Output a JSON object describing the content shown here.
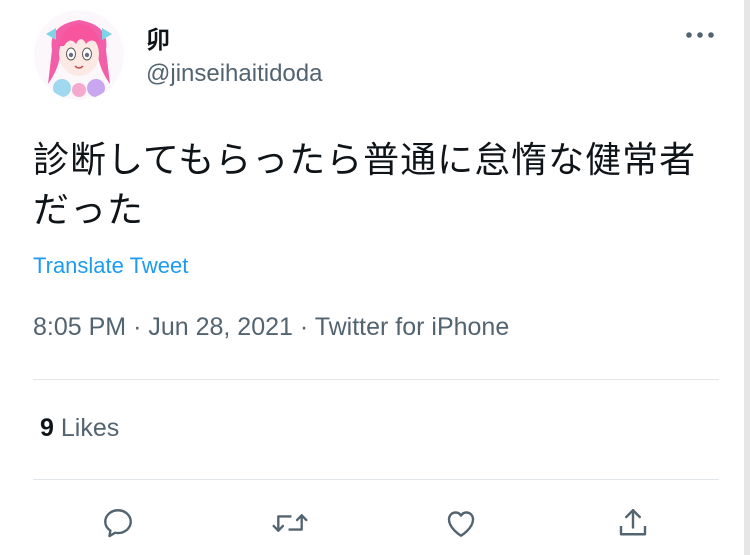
{
  "user": {
    "display_name": "卯",
    "handle": "@jinseihaitidoda",
    "avatar_icon": "anime-avatar"
  },
  "tweet": {
    "text": "診断してもらったら普通に怠惰な健常者だった",
    "translate_label": "Translate Tweet",
    "time": "8:05 PM",
    "date": "Jun 28, 2021",
    "source": "Twitter for iPhone",
    "separator": "·"
  },
  "stats": {
    "likes_count": "9",
    "likes_label": "Likes"
  },
  "actions": {
    "reply_icon": "reply-icon",
    "retweet_icon": "retweet-icon",
    "like_icon": "heart-icon",
    "share_icon": "share-icon"
  },
  "colors": {
    "link": "#1d9bf0",
    "secondary_text": "#536471",
    "divider": "#e1e6ea",
    "primary_text": "#0f1419"
  }
}
